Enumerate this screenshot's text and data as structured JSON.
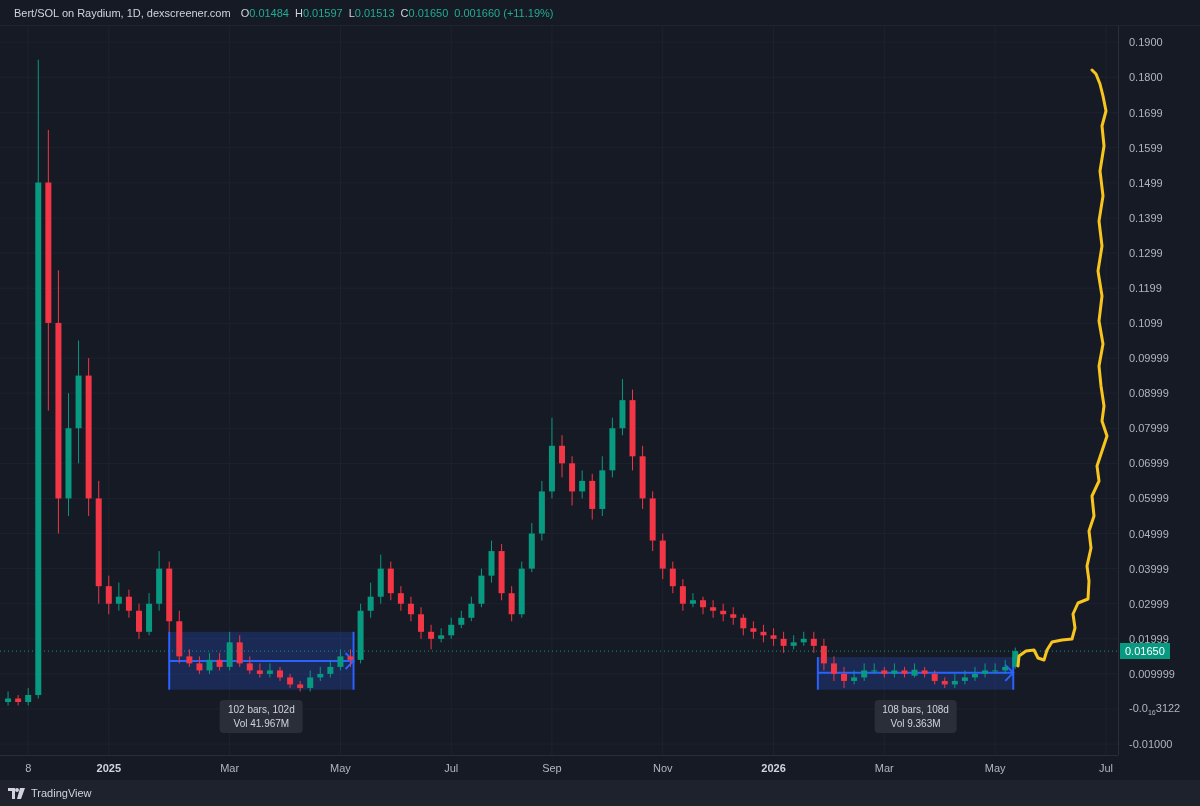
{
  "header": {
    "symbol": "Bert/SOL on Raydium, 1D, dexscreener.com",
    "ohlc": [
      {
        "key": "O",
        "value": "0.01484"
      },
      {
        "key": "H",
        "value": "0.01597"
      },
      {
        "key": "L",
        "value": "0.01513"
      },
      {
        "key": "C",
        "value": "0.01650"
      }
    ],
    "change": "0.001660 (+11.19%)"
  },
  "chart": {
    "chart_data": {
      "type": "candlestick",
      "grid": true,
      "ylim": [
        -0.0131,
        0.1946
      ],
      "yticks": [
        {
          "value": 0.19,
          "label": "0.1900"
        },
        {
          "value": 0.18,
          "label": "0.1800"
        },
        {
          "value": 0.1699,
          "label": "0.1699"
        },
        {
          "value": 0.1599,
          "label": "0.1599"
        },
        {
          "value": 0.1499,
          "label": "0.1499"
        },
        {
          "value": 0.1399,
          "label": "0.1399"
        },
        {
          "value": 0.1299,
          "label": "0.1299"
        },
        {
          "value": 0.1199,
          "label": "0.1199"
        },
        {
          "value": 0.1099,
          "label": "0.1099"
        },
        {
          "value": 0.09999,
          "label": "0.09999"
        },
        {
          "value": 0.08999,
          "label": "0.08999"
        },
        {
          "value": 0.07999,
          "label": "0.07999"
        },
        {
          "value": 0.06999,
          "label": "0.06999"
        },
        {
          "value": 0.05999,
          "label": "0.05999"
        },
        {
          "value": 0.04999,
          "label": "0.04999"
        },
        {
          "value": 0.03999,
          "label": "0.03999"
        },
        {
          "value": 0.02999,
          "label": "0.02999"
        },
        {
          "value": 0.01999,
          "label": "0.01999"
        },
        {
          "value": 0.009999,
          "label": "0.009999"
        },
        {
          "value": -3.122e-17,
          "label": "-0.0$_{16}$3122"
        },
        {
          "value": -0.01,
          "label": "-0.01000"
        }
      ],
      "categories": [
        null,
        null,
        "8",
        null,
        null,
        null,
        null,
        null,
        null,
        null,
        "2025",
        null,
        null,
        null,
        null,
        null,
        null,
        null,
        null,
        null,
        null,
        null,
        "Mar",
        null,
        null,
        null,
        null,
        null,
        null,
        null,
        null,
        null,
        null,
        "May",
        null,
        null,
        null,
        null,
        null,
        null,
        null,
        null,
        null,
        null,
        "Jul",
        null,
        null,
        null,
        null,
        null,
        null,
        null,
        null,
        null,
        "Sep",
        null,
        null,
        null,
        null,
        null,
        null,
        null,
        null,
        null,
        null,
        "Nov",
        null,
        null,
        null,
        null,
        null,
        null,
        null,
        null,
        null,
        null,
        "2026",
        null,
        null,
        null,
        null,
        null,
        null,
        null,
        null,
        null,
        null,
        "Mar",
        null,
        null,
        null,
        null,
        null,
        null,
        null,
        null,
        null,
        null,
        "May",
        null,
        null,
        null,
        null,
        null,
        null,
        null,
        null,
        null,
        null,
        "Jul"
      ],
      "ohlc": [
        [
          0.002,
          0.005,
          0.001,
          0.003
        ],
        [
          0.003,
          0.004,
          0.001,
          0.002
        ],
        [
          0.002,
          0.006,
          0.001,
          0.004
        ],
        [
          0.004,
          0.185,
          0.003,
          0.15
        ],
        [
          0.15,
          0.165,
          0.085,
          0.11
        ],
        [
          0.11,
          0.125,
          0.05,
          0.06
        ],
        [
          0.06,
          0.09,
          0.055,
          0.08
        ],
        [
          0.08,
          0.105,
          0.07,
          0.095
        ],
        [
          0.095,
          0.1,
          0.055,
          0.06
        ],
        [
          0.06,
          0.065,
          0.03,
          0.035
        ],
        [
          0.035,
          0.038,
          0.027,
          0.03
        ],
        [
          0.03,
          0.036,
          0.028,
          0.032
        ],
        [
          0.032,
          0.034,
          0.026,
          0.028
        ],
        [
          0.028,
          0.03,
          0.02,
          0.022
        ],
        [
          0.022,
          0.033,
          0.021,
          0.03
        ],
        [
          0.03,
          0.045,
          0.028,
          0.04
        ],
        [
          0.04,
          0.042,
          0.022,
          0.025
        ],
        [
          0.025,
          0.028,
          0.013,
          0.015
        ],
        [
          0.015,
          0.017,
          0.012,
          0.013
        ],
        [
          0.013,
          0.015,
          0.01,
          0.011
        ],
        [
          0.011,
          0.016,
          0.01,
          0.014
        ],
        [
          0.014,
          0.016,
          0.011,
          0.012
        ],
        [
          0.012,
          0.022,
          0.011,
          0.019
        ],
        [
          0.019,
          0.021,
          0.012,
          0.013
        ],
        [
          0.013,
          0.015,
          0.01,
          0.011
        ],
        [
          0.011,
          0.013,
          0.009,
          0.01
        ],
        [
          0.01,
          0.013,
          0.009,
          0.011
        ],
        [
          0.011,
          0.012,
          0.008,
          0.009
        ],
        [
          0.009,
          0.01,
          0.006,
          0.007
        ],
        [
          0.007,
          0.008,
          0.005,
          0.006
        ],
        [
          0.006,
          0.011,
          0.005,
          0.009
        ],
        [
          0.009,
          0.012,
          0.008,
          0.01
        ],
        [
          0.01,
          0.014,
          0.009,
          0.012
        ],
        [
          0.012,
          0.017,
          0.011,
          0.015
        ],
        [
          0.015,
          0.017,
          0.012,
          0.014
        ],
        [
          0.014,
          0.03,
          0.013,
          0.028
        ],
        [
          0.028,
          0.036,
          0.026,
          0.032
        ],
        [
          0.032,
          0.044,
          0.03,
          0.04
        ],
        [
          0.04,
          0.042,
          0.031,
          0.033
        ],
        [
          0.033,
          0.035,
          0.028,
          0.03
        ],
        [
          0.03,
          0.032,
          0.025,
          0.027
        ],
        [
          0.027,
          0.029,
          0.02,
          0.022
        ],
        [
          0.022,
          0.024,
          0.017,
          0.02
        ],
        [
          0.02,
          0.023,
          0.019,
          0.021
        ],
        [
          0.021,
          0.026,
          0.02,
          0.024
        ],
        [
          0.024,
          0.028,
          0.023,
          0.026
        ],
        [
          0.026,
          0.032,
          0.025,
          0.03
        ],
        [
          0.03,
          0.04,
          0.029,
          0.038
        ],
        [
          0.038,
          0.048,
          0.036,
          0.045
        ],
        [
          0.045,
          0.047,
          0.031,
          0.033
        ],
        [
          0.033,
          0.035,
          0.025,
          0.027
        ],
        [
          0.027,
          0.042,
          0.026,
          0.04
        ],
        [
          0.04,
          0.053,
          0.039,
          0.05
        ],
        [
          0.05,
          0.065,
          0.048,
          0.062
        ],
        [
          0.062,
          0.083,
          0.06,
          0.075
        ],
        [
          0.075,
          0.078,
          0.066,
          0.07
        ],
        [
          0.07,
          0.072,
          0.058,
          0.062
        ],
        [
          0.062,
          0.068,
          0.06,
          0.065
        ],
        [
          0.065,
          0.067,
          0.054,
          0.057
        ],
        [
          0.057,
          0.072,
          0.055,
          0.068
        ],
        [
          0.068,
          0.083,
          0.066,
          0.08
        ],
        [
          0.08,
          0.094,
          0.078,
          0.088
        ],
        [
          0.088,
          0.091,
          0.068,
          0.072
        ],
        [
          0.072,
          0.075,
          0.057,
          0.06
        ],
        [
          0.06,
          0.062,
          0.045,
          0.048
        ],
        [
          0.048,
          0.05,
          0.037,
          0.04
        ],
        [
          0.04,
          0.042,
          0.033,
          0.035
        ],
        [
          0.035,
          0.037,
          0.028,
          0.03
        ],
        [
          0.03,
          0.033,
          0.029,
          0.031
        ],
        [
          0.031,
          0.032,
          0.027,
          0.029
        ],
        [
          0.029,
          0.031,
          0.026,
          0.028
        ],
        [
          0.028,
          0.03,
          0.025,
          0.027
        ],
        [
          0.027,
          0.029,
          0.024,
          0.026
        ],
        [
          0.026,
          0.027,
          0.021,
          0.023
        ],
        [
          0.023,
          0.025,
          0.02,
          0.022
        ],
        [
          0.022,
          0.024,
          0.019,
          0.021
        ],
        [
          0.021,
          0.023,
          0.018,
          0.02
        ],
        [
          0.02,
          0.022,
          0.016,
          0.018
        ],
        [
          0.018,
          0.021,
          0.017,
          0.019
        ],
        [
          0.019,
          0.022,
          0.018,
          0.02
        ],
        [
          0.02,
          0.022,
          0.016,
          0.018
        ],
        [
          0.018,
          0.02,
          0.011,
          0.013
        ],
        [
          0.013,
          0.015,
          0.008,
          0.01
        ],
        [
          0.01,
          0.012,
          0.006,
          0.008
        ],
        [
          0.008,
          0.011,
          0.007,
          0.009
        ],
        [
          0.009,
          0.013,
          0.008,
          0.011
        ],
        [
          0.011,
          0.013,
          0.01,
          0.011
        ],
        [
          0.011,
          0.012,
          0.009,
          0.01
        ],
        [
          0.01,
          0.013,
          0.009,
          0.011
        ],
        [
          0.011,
          0.012,
          0.009,
          0.01
        ],
        [
          0.0095,
          0.013,
          0.009,
          0.0112
        ],
        [
          0.011,
          0.012,
          0.009,
          0.01
        ],
        [
          0.01,
          0.011,
          0.007,
          0.008
        ],
        [
          0.008,
          0.009,
          0.006,
          0.007
        ],
        [
          0.007,
          0.01,
          0.006,
          0.008
        ],
        [
          0.008,
          0.011,
          0.007,
          0.009
        ],
        [
          0.009,
          0.012,
          0.008,
          0.01
        ],
        [
          0.01,
          0.013,
          0.009,
          0.011
        ],
        [
          0.011,
          0.013,
          0.01,
          0.011
        ],
        [
          0.011,
          0.014,
          0.01,
          0.012
        ],
        [
          0.012,
          0.0175,
          0.0115,
          0.0165
        ],
        null,
        null,
        null,
        null,
        null,
        null,
        null,
        null,
        null
      ],
      "annotations": [
        "102 bars, 102d",
        "Vol 41.967M",
        "108 bars, 108d",
        "Vol 9.363M"
      ]
    },
    "last_price": "0.01650"
  },
  "footer": {
    "brand": "TradingView"
  }
}
